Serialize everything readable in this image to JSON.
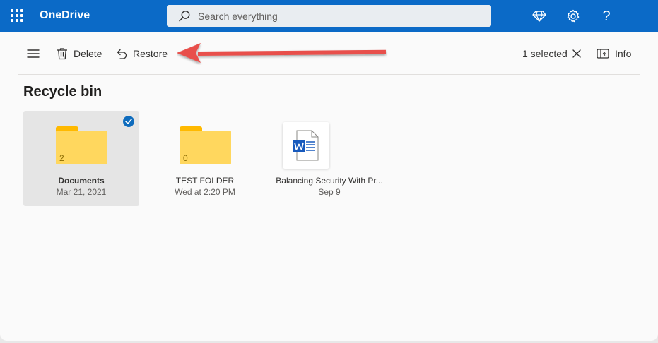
{
  "app": {
    "name": "OneDrive"
  },
  "search": {
    "placeholder": "Search everything"
  },
  "header_icons": [
    "premium-diamond-icon",
    "settings-gear-icon",
    "help-question-icon"
  ],
  "header": {
    "help_glyph": "?"
  },
  "commandbar": {
    "delete_label": "Delete",
    "restore_label": "Restore",
    "selected_label": "1 selected",
    "info_label": "Info"
  },
  "page": {
    "title": "Recycle bin"
  },
  "items": [
    {
      "name": "Documents",
      "date": "Mar 21, 2021",
      "type": "folder",
      "count": "2",
      "selected": true
    },
    {
      "name": "TEST FOLDER",
      "date": "Wed at 2:20 PM",
      "type": "folder",
      "count": "0",
      "selected": false
    },
    {
      "name": "Balancing Security With Pr...",
      "date": "Sep 9",
      "type": "word-document",
      "selected": false
    }
  ],
  "colors": {
    "brand_blue": "#0b6ac7",
    "folder_yellow": "#ffd75e",
    "annotation_arrow": "#e8504b",
    "word_blue": "#185abd"
  }
}
